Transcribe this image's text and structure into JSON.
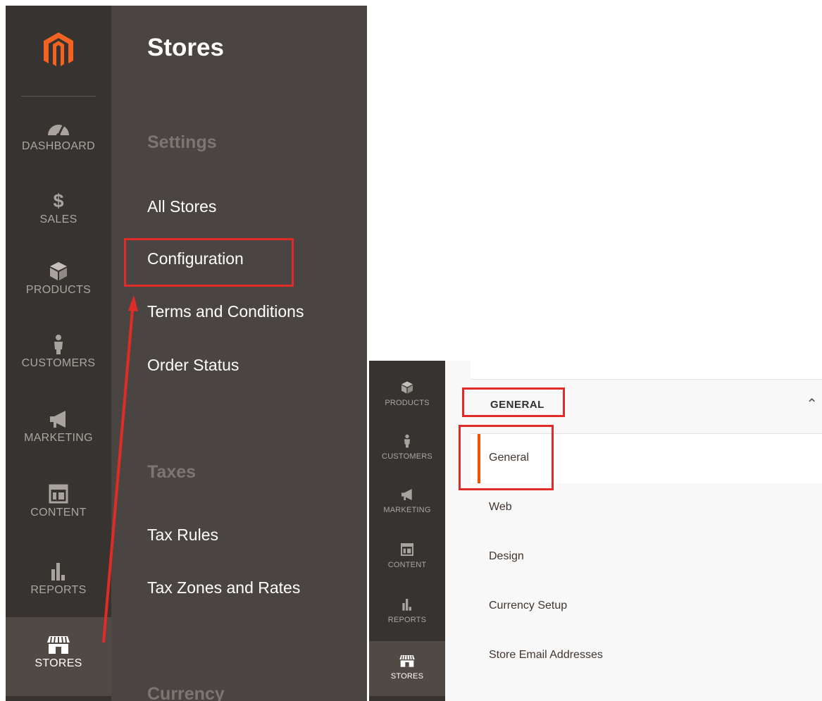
{
  "sidebar": {
    "items": [
      {
        "label": "DASHBOARD",
        "icon": "dashboard-icon"
      },
      {
        "label": "SALES",
        "icon": "dollar-icon"
      },
      {
        "label": "PRODUCTS",
        "icon": "box-icon"
      },
      {
        "label": "CUSTOMERS",
        "icon": "person-icon"
      },
      {
        "label": "MARKETING",
        "icon": "megaphone-icon"
      },
      {
        "label": "CONTENT",
        "icon": "layout-icon"
      },
      {
        "label": "REPORTS",
        "icon": "bar-chart-icon"
      },
      {
        "label": "STORES",
        "icon": "storefront-icon",
        "active": true
      }
    ]
  },
  "flyout": {
    "title": "Stores",
    "sections": [
      {
        "heading": "Settings",
        "links": [
          "All Stores",
          "Configuration",
          "Terms and Conditions",
          "Order Status"
        ]
      },
      {
        "heading": "Taxes",
        "links": [
          "Tax Rules",
          "Tax Zones and Rates"
        ]
      },
      {
        "heading": "Currency",
        "links": []
      }
    ]
  },
  "mini_sidebar": {
    "items": [
      {
        "label": "PRODUCTS",
        "icon": "box-icon"
      },
      {
        "label": "CUSTOMERS",
        "icon": "person-icon"
      },
      {
        "label": "MARKETING",
        "icon": "megaphone-icon"
      },
      {
        "label": "CONTENT",
        "icon": "layout-icon"
      },
      {
        "label": "REPORTS",
        "icon": "bar-chart-icon"
      },
      {
        "label": "STORES",
        "icon": "storefront-icon",
        "active": true
      }
    ]
  },
  "config_tabs": {
    "group_label": "GENERAL",
    "items": [
      "General",
      "Web",
      "Design",
      "Currency Setup",
      "Store Email Addresses"
    ],
    "active_item": "General"
  },
  "colors": {
    "sidebar_bg": "#373330",
    "flyout_bg": "#4a4542",
    "accent": "#eb5202",
    "highlight": "#e02b27",
    "logo": "#f26322"
  }
}
